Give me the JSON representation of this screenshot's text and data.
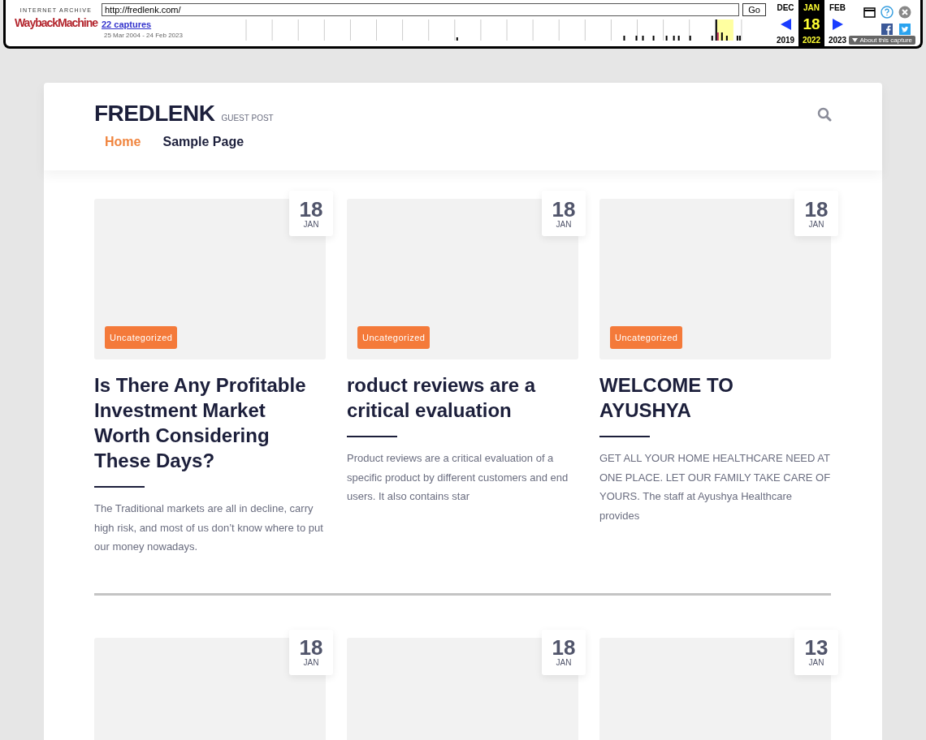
{
  "wayback": {
    "logo_top": "INTERNET ARCHIVE",
    "logo_main": "WaybackMachine",
    "url": "http://fredlenk.com/",
    "go": "Go",
    "captures": "22 captures",
    "range": "25 Mar 2004 - 24 Feb 2023",
    "months": [
      {
        "month": "DEC",
        "year": "2019",
        "selected": false
      },
      {
        "month": "JAN",
        "year": "2022",
        "selected": true
      },
      {
        "month": "FEB",
        "year": "2023",
        "selected": false
      }
    ],
    "day": "18",
    "about": "About this capture"
  },
  "site": {
    "title": "FREDLENK",
    "tagline": "GUEST POST",
    "nav": [
      {
        "label": "Home",
        "selected": true
      },
      {
        "label": "Sample Page",
        "selected": false
      }
    ],
    "posts": [
      {
        "day": "18",
        "month": "JAN",
        "category": "Uncategorized",
        "title": "Is There Any Profitable Investment Market Worth Considering These Days?",
        "excerpt": "The Traditional markets are all in decline, carry high risk, and most of us don’t know where to put our money nowadays."
      },
      {
        "day": "18",
        "month": "JAN",
        "category": "Uncategorized",
        "title": "roduct reviews are a critical evaluation",
        "excerpt": "Product reviews are a critical evaluation of a specific product by different customers and end users. It also contains star"
      },
      {
        "day": "18",
        "month": "JAN",
        "category": "Uncategorized",
        "title": "WELCOME TO AYUSHYA",
        "excerpt": "GET ALL YOUR HOME HEALTHCARE NEED AT ONE PLACE. LET OUR FAMILY TAKE CARE OF YOURS. The staff at Ayushya Healthcare provides"
      },
      {
        "day": "18",
        "month": "JAN"
      },
      {
        "day": "18",
        "month": "JAN"
      },
      {
        "day": "13",
        "month": "JAN"
      }
    ]
  }
}
